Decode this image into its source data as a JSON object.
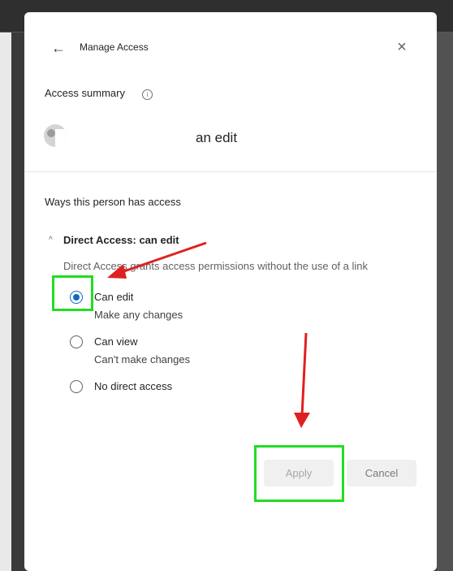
{
  "dialog": {
    "title": "Manage Access",
    "back_icon": "arrow-left-icon",
    "close_icon": "close-icon"
  },
  "summary": {
    "label": "Access summary",
    "info_icon": "info-icon",
    "person_name": "an edit"
  },
  "access": {
    "heading": "Ways this person has access",
    "section_title": "Direct Access: can edit",
    "section_description": "Direct Access grants access permissions without the use of a link",
    "options": [
      {
        "label": "Can edit",
        "sublabel": "Make any changes",
        "checked": true
      },
      {
        "label": "Can view",
        "sublabel": "Can't make changes",
        "checked": false
      },
      {
        "label": "No direct access",
        "sublabel": "",
        "checked": false
      }
    ]
  },
  "buttons": {
    "apply": "Apply",
    "cancel": "Cancel"
  },
  "colors": {
    "accent": "#0f6cbd",
    "annotation_highlight": "#22dd22",
    "annotation_arrow": "#e02020"
  }
}
